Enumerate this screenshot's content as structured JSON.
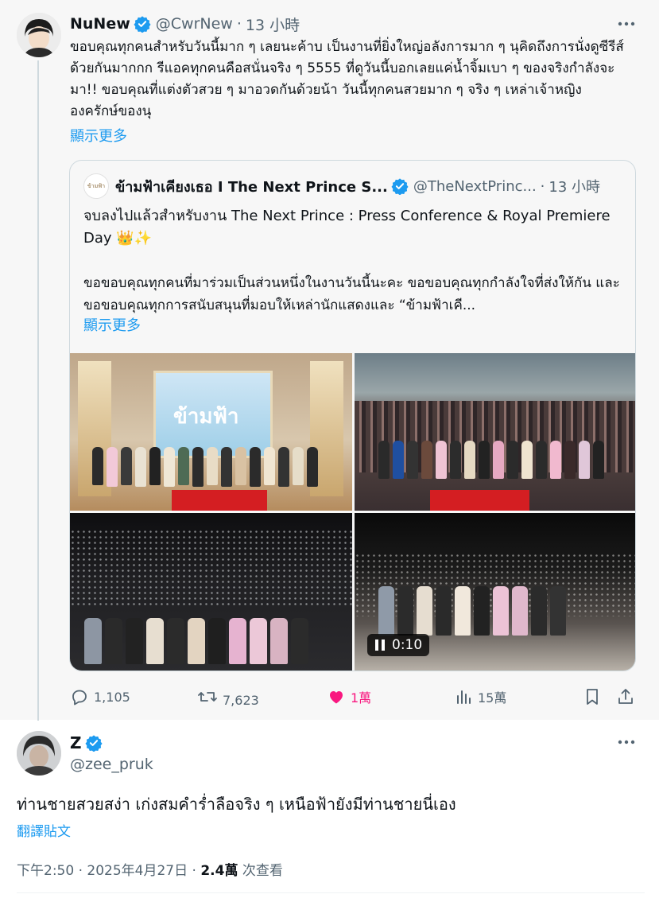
{
  "parent_tweet": {
    "display_name": "NuNew",
    "handle": "@CwrNew",
    "separator": "·",
    "time": "13 小時",
    "text": "ขอบคุณทุกคนสำหรับวันนี้มาก ๆ เลยนะค้าบ เป็นงานที่ยิ่งใหญ่อลังการมาก ๆ นุคิดถึงการนั่งดูซีรีส์ด้วยกันมากกก รีแอคทุกคนคือสนั่นจริง ๆ 5555 ที่ดูวันนี้บอกเลยแค่น้ำจิ้มเบา ๆ ของจริงกำลังจะมา!! ขอบคุณที่แต่งตัวสวย ๆ มาอวดกันด้วยน้า วันนี้ทุกคนสวยมาก ๆ จริง ๆ เหล่าเจ้าหญิงองครักษ์ของนุ",
    "show_more": "顯示更多",
    "quote": {
      "avatar_text": "ข้ามฟ้า",
      "display_name": "ข้ามฟ้าเคียงเธอ I The Next Prince S...",
      "handle": "@TheNextPrinc...",
      "separator": "·",
      "time": "13 小時",
      "text_1": "จบลงไปแล้วสำหรับงาน The Next Prince : Press Conference & Royal Premiere Day 👑✨",
      "text_2": "ขอขอบคุณทุกคนที่มาร่วมเป็นส่วนหนึ่งในงานวันนี้นะคะ ขอขอบคุณทุกกำลังใจที่ส่งให้กัน และขอขอบคุณทุกการสนับสนุนที่มอบให้เหล่านักแสดงและ “ข้ามฟ้าเคี...",
      "show_more": "顯示更多",
      "media": {
        "screen_text": "ข้ามฟ้า",
        "video_time": "0:10"
      }
    },
    "actions": {
      "replies": "1,105",
      "reposts": "7,623",
      "likes": "1萬",
      "views": "15萬"
    }
  },
  "reply_tweet": {
    "display_name": "Z",
    "handle": "@zee_pruk",
    "text": "ท่านชายสวยสง่า เก่งสมคำร่ำลือจริง ๆ เหนือฟ้ายังมีท่านชายนี่เอง",
    "translate": "翻譯貼文",
    "meta": {
      "time": "下午2:50",
      "separator": "·",
      "date": "2025年4月27日",
      "views_count": "2.4萬",
      "views_label": "次查看"
    }
  },
  "colors": {
    "accent": "#1d9bf0",
    "like": "#f91880",
    "secondary_text": "#536471"
  }
}
